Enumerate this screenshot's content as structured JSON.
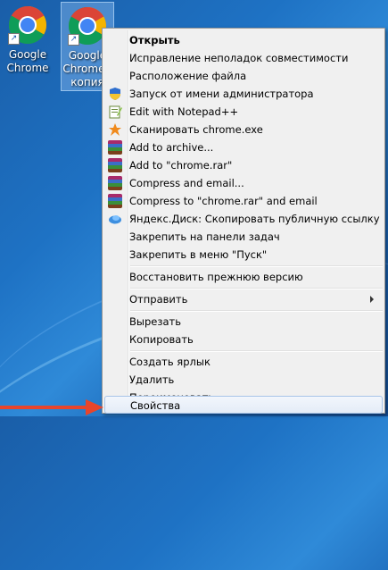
{
  "desktop": {
    "icons": [
      {
        "label": "Google\nChrome"
      },
      {
        "label": "Google\nChrome -\nкопия"
      }
    ]
  },
  "menu": {
    "items": [
      {
        "label": "Открыть",
        "bold": true
      },
      {
        "label": "Исправление неполадок совместимости"
      },
      {
        "label": "Расположение файла"
      },
      {
        "label": "Запуск от имени администратора",
        "icon": "uac-shield-icon"
      },
      {
        "label": "Edit with Notepad++",
        "icon": "notepad-plus-plus-icon"
      },
      {
        "label": "Сканировать chrome.exe",
        "icon": "antivirus-scan-icon"
      },
      {
        "label": "Add to archive...",
        "icon": "winrar-icon"
      },
      {
        "label": "Add to \"chrome.rar\"",
        "icon": "winrar-icon"
      },
      {
        "label": "Compress and email...",
        "icon": "winrar-icon"
      },
      {
        "label": "Compress to \"chrome.rar\" and email",
        "icon": "winrar-icon"
      },
      {
        "label": "Яндекс.Диск: Скопировать публичную ссылку",
        "icon": "yandex-disk-icon"
      },
      {
        "label": "Закрепить на панели задач"
      },
      {
        "label": "Закрепить в меню \"Пуск\""
      },
      {
        "label": "Восстановить прежнюю версию"
      },
      {
        "label": "Отправить",
        "submenu": true
      },
      {
        "label": "Вырезать"
      },
      {
        "label": "Копировать"
      },
      {
        "label": "Создать ярлык"
      },
      {
        "label": "Удалить"
      },
      {
        "label": "Переименовать"
      },
      {
        "label": "Свойства",
        "highlighted": true
      }
    ]
  },
  "colors": {
    "pointer_arrow": "#e8452c",
    "menu_bg": "#f0f0f0"
  }
}
